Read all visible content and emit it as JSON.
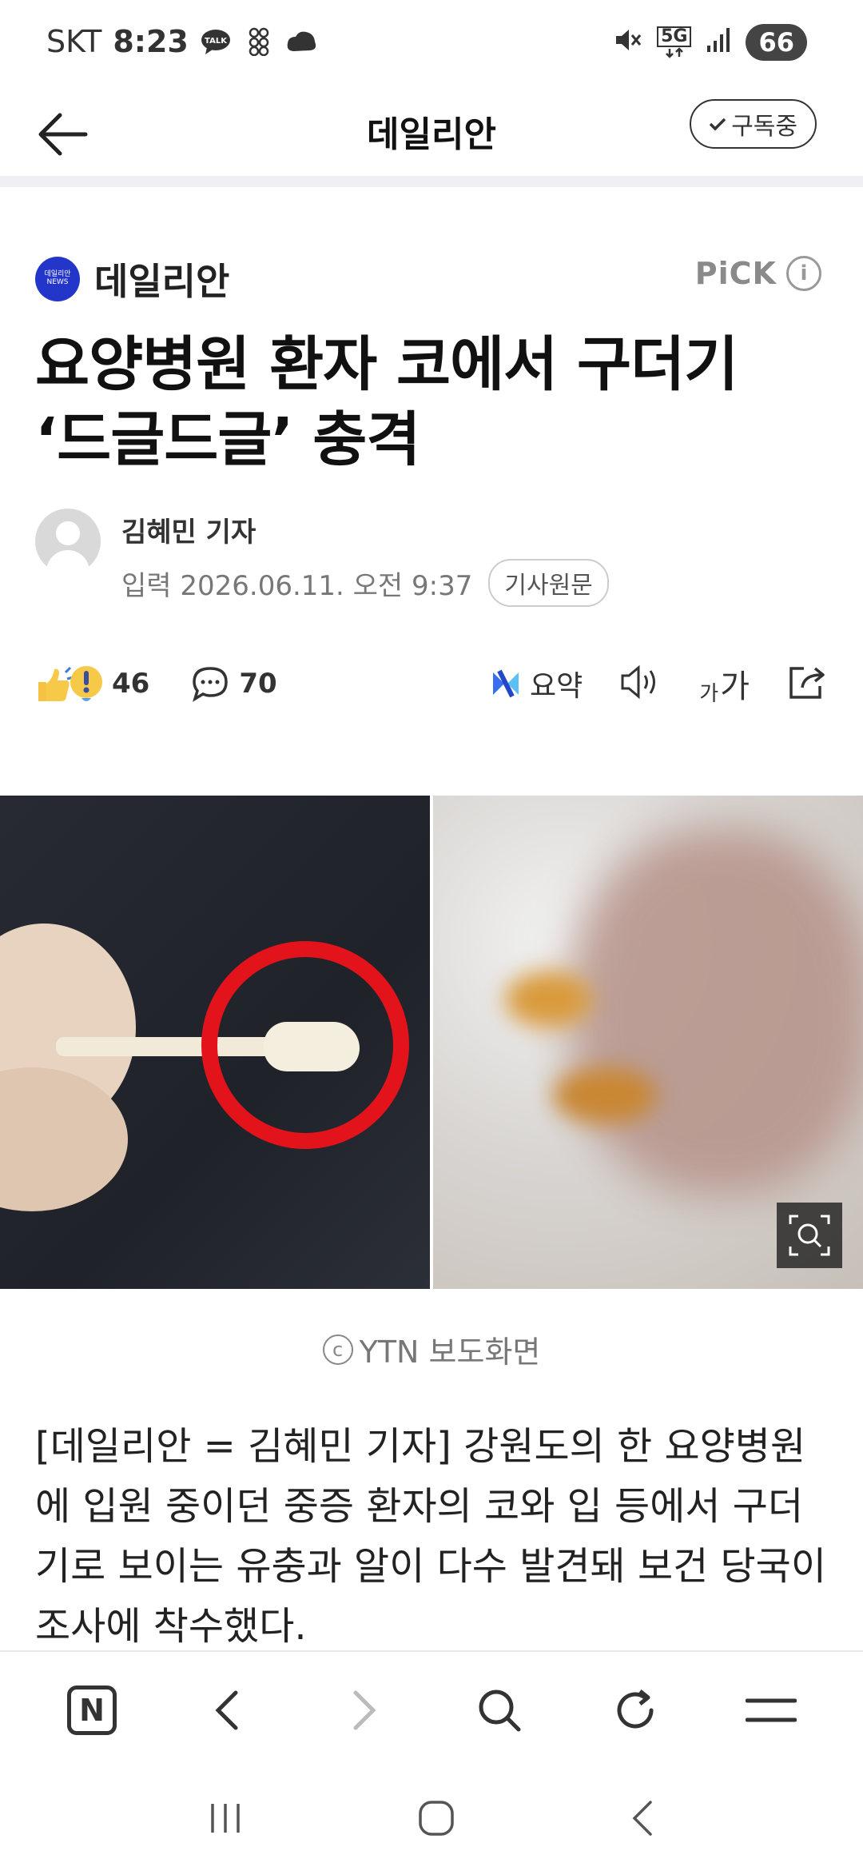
{
  "status_bar": {
    "carrier": "SKT",
    "time": "8:23",
    "network": "5G",
    "battery": "66"
  },
  "app_bar": {
    "title": "데일리안",
    "subscribe_label": "구독중"
  },
  "press": {
    "name": "데일리안",
    "logo_line1": "데일리안",
    "logo_line2": "NEWS",
    "pick_label": "PiCK"
  },
  "article": {
    "headline_line1": "요양병원 환자 코에서 구더기",
    "headline_line2": "‘드글드글’ 충격",
    "author": "김혜민 기자",
    "published": "입력 2026.06.11. 오전 9:37",
    "original_label": "기사원문",
    "reaction_count": "46",
    "comment_count": "70",
    "summary_label": "요약",
    "font_small": "가",
    "font_large": "가",
    "photo_caption": "YTN 보도화면",
    "body": "[데일리안 = 김혜민 기자] 강원도의 한 요양병원에 입원 중이던 중증 환자의 코와 입 등에서 구더기로 보이는 유충과 알이 다수 발견돼 보건 당국이 조사에 착수했다."
  },
  "colors": {
    "accent_red": "#e3131b",
    "press_logo_blue": "#2436c9"
  }
}
